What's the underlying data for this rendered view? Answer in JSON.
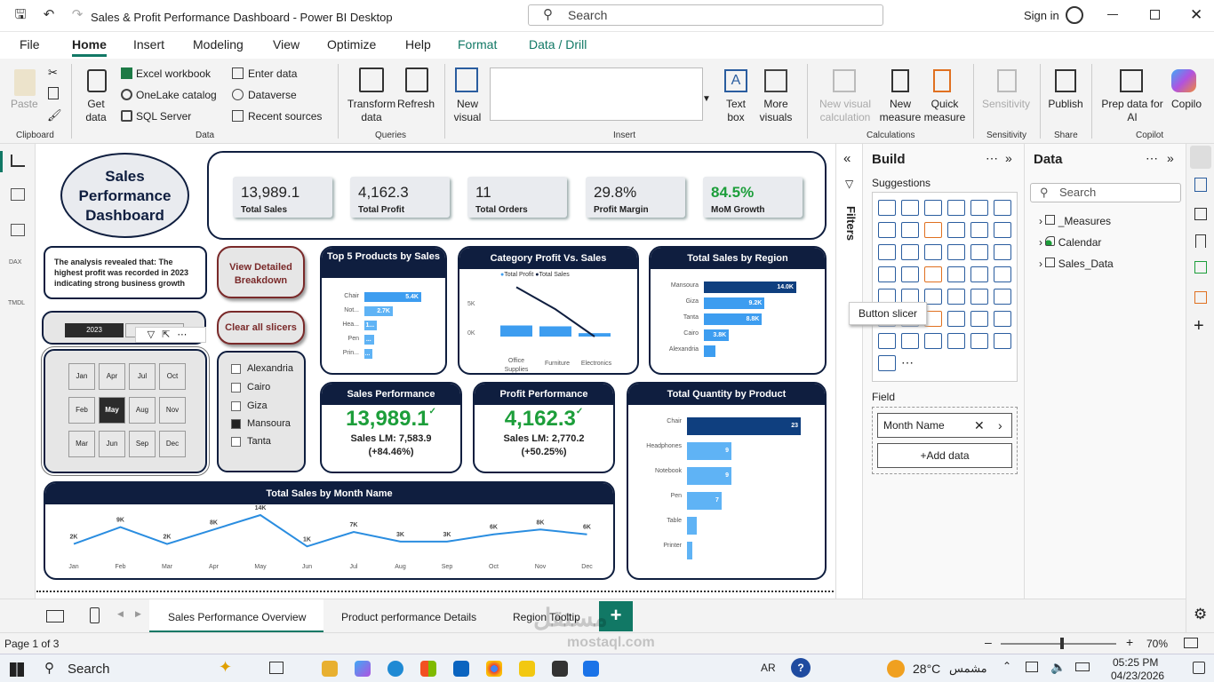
{
  "title": "Sales & Profit Performance Dashboard - Power BI Desktop",
  "search": "Search",
  "sign_in": "Sign in",
  "menu": [
    "File",
    "Home",
    "Insert",
    "Modeling",
    "View",
    "Optimize",
    "Help",
    "Format",
    "Data / Drill"
  ],
  "ribbon": {
    "paste": "Paste",
    "clipboard": "Clipboard",
    "get_data": "Get data",
    "excel": "Excel workbook",
    "onelake": "OneLake catalog",
    "sql": "SQL Server",
    "enter_data": "Enter data",
    "dataverse": "Dataverse",
    "recent": "Recent sources",
    "data": "Data",
    "transform": "Transform data",
    "refresh": "Refresh",
    "queries": "Queries",
    "new_visual": "New visual",
    "text_box": "Text box",
    "more_visuals": "More visuals",
    "insert": "Insert",
    "new_calc": "New visual calculation",
    "new_measure": "New measure",
    "quick_measure": "Quick measure",
    "calculations": "Calculations",
    "sensitivity": "Sensitivity",
    "publish": "Publish",
    "share": "Share",
    "prep": "Prep data for AI",
    "copilot_btn": "Copilo",
    "copilot": "Copilot"
  },
  "dashboard": {
    "title": "Sales Performance Dashboard",
    "kpis": [
      {
        "value": "13,989.1",
        "label": "Total Sales"
      },
      {
        "value": "4,162.3",
        "label": "Total Profit"
      },
      {
        "value": "11",
        "label": "Total Orders"
      },
      {
        "value": "29.8%",
        "label": "Profit Margin"
      },
      {
        "value": "84.5%",
        "label": "MoM Growth"
      }
    ],
    "analysis": "The analysis revealed that: The highest profit was recorded in 2023 indicating strong business growth",
    "view_detailed": "View Detailed Breakdown",
    "clear_slicers": "Clear all slicers",
    "year": "2023",
    "months": [
      "Jan",
      "Apr",
      "Jul",
      "Oct",
      "Feb",
      "May",
      "Aug",
      "Nov",
      "Mar",
      "Jun",
      "Sep",
      "Dec"
    ],
    "selected_month": "May",
    "regions": [
      "Alexandria",
      "Cairo",
      "Giza",
      "Mansoura",
      "Tanta"
    ],
    "checked_region": "Mansoura",
    "top5": {
      "title": "Top 5 Products by Sales",
      "rows": [
        {
          "label": "Chair",
          "text": "5.4K"
        },
        {
          "label": "Not...",
          "text": "2.7K"
        },
        {
          "label": "Hea...",
          "text": "1..."
        },
        {
          "label": "Pen",
          "text": "..."
        },
        {
          "label": "Prin...",
          "text": "..."
        }
      ]
    },
    "cat": {
      "title": "Category Profit Vs. Sales",
      "legend1": "Total Profit",
      "legend2": "Total Sales",
      "y5": "5K",
      "y0": "0K",
      "cats": [
        "Office Supplies",
        "Furniture",
        "Electronics"
      ]
    },
    "region": {
      "title": "Total Sales by Region",
      "rows": [
        {
          "label": "Mansoura",
          "text": "14.0K"
        },
        {
          "label": "Giza",
          "text": "9.2K"
        },
        {
          "label": "Tanta",
          "text": "8.8K"
        },
        {
          "label": "Cairo",
          "text": "3.8K"
        },
        {
          "label": "Alexandria",
          "text": ""
        }
      ]
    },
    "sales_perf": {
      "title": "Sales Performance",
      "value": "13,989.1",
      "lm": "Sales LM: 7,583.9",
      "pct": "(+84.46%)"
    },
    "profit_perf": {
      "title": "Profit Performance",
      "value": "4,162.3",
      "lm": "Sales LM: 2,770.2",
      "pct": "(+50.25%)"
    },
    "qty": {
      "title": "Total Quantity by Product",
      "rows": [
        {
          "label": "Chair",
          "text": "23"
        },
        {
          "label": "Headphones",
          "text": "9"
        },
        {
          "label": "Notebook",
          "text": "9"
        },
        {
          "label": "Pen",
          "text": "7"
        },
        {
          "label": "Table",
          "text": ""
        },
        {
          "label": "Printer",
          "text": ""
        }
      ]
    },
    "month_chart": {
      "title": "Total Sales by Month Name",
      "labels": [
        "2K",
        "9K",
        "2K",
        "8K",
        "14K",
        "1K",
        "7K",
        "3K",
        "3K",
        "6K",
        "8K",
        "6K"
      ]
    }
  },
  "chart_data": [
    {
      "type": "bar",
      "title": "Top 5 Products by Sales",
      "categories": [
        "Chair",
        "Not...",
        "Hea...",
        "Pen",
        "Prin..."
      ],
      "values": [
        5400,
        2700,
        1200,
        900,
        800
      ]
    },
    {
      "type": "bar",
      "title": "Category Profit Vs. Sales",
      "categories": [
        "Office Supplies",
        "Furniture",
        "Electronics"
      ],
      "series": [
        {
          "name": "Total Profit",
          "values": [
            1300,
            1200,
            400
          ]
        },
        {
          "name": "Total Sales",
          "values": [
            5800,
            3200,
            0
          ]
        }
      ]
    },
    {
      "type": "bar",
      "title": "Total Sales by Region",
      "categories": [
        "Mansoura",
        "Giza",
        "Tanta",
        "Cairo",
        "Alexandria"
      ],
      "values": [
        14000,
        9200,
        8800,
        3800,
        1800
      ]
    },
    {
      "type": "bar",
      "title": "Total Quantity by Product",
      "categories": [
        "Chair",
        "Headphones",
        "Notebook",
        "Pen",
        "Table",
        "Printer"
      ],
      "values": [
        23,
        9,
        9,
        7,
        2,
        1
      ]
    },
    {
      "type": "line",
      "title": "Total Sales by Month Name",
      "categories": [
        "Jan",
        "Feb",
        "Mar",
        "Apr",
        "May",
        "Jun",
        "Jul",
        "Aug",
        "Sep",
        "Oct",
        "Nov",
        "Dec"
      ],
      "values": [
        2000,
        9000,
        2000,
        8000,
        14000,
        1000,
        7000,
        3000,
        3000,
        6000,
        8000,
        6000
      ]
    }
  ],
  "filters": "Filters",
  "build": {
    "title": "Build",
    "suggestions": "Suggestions",
    "tooltip": "Button slicer",
    "field": "Field",
    "field_value": "Month Name",
    "add_data": "+Add data"
  },
  "data_pane": {
    "title": "Data",
    "search": "Search",
    "items": [
      "_Measures",
      "Calendar",
      "Sales_Data"
    ]
  },
  "tabs": [
    "Sales Performance Overview",
    "Product performance Details",
    "Region Tooltip"
  ],
  "page": "Page 1 of 3",
  "zoom": "70%",
  "taskbar": {
    "search": "Search",
    "lang": "AR",
    "temp": "28°C",
    "weather": "مشمس",
    "time": "05:25 PM",
    "date": "04/23/2026"
  },
  "watermark": "mostaql.com"
}
